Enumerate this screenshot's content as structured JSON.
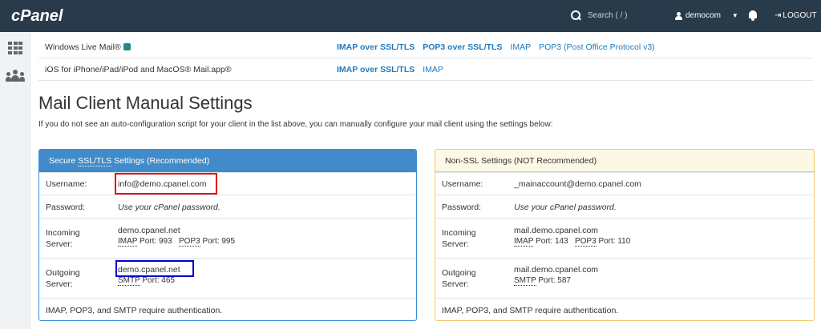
{
  "topbar": {
    "logo": "cPanel",
    "search_placeholder": "Search ( / )",
    "user": "democom",
    "logout": "LOGOUT"
  },
  "clients": [
    {
      "name": "Windows Live Mail®",
      "links": [
        "IMAP over SSL/TLS",
        "POP3 over SSL/TLS",
        "IMAP",
        "POP3 (Post Office Protocol v3)"
      ]
    },
    {
      "name": "iOS for iPhone/iPad/iPod and MacOS® Mail.app®",
      "links": [
        "IMAP over SSL/TLS",
        "IMAP"
      ]
    }
  ],
  "heading": "Mail Client Manual Settings",
  "intro": "If you do not see an auto-configuration script for your client in the list above, you can manually configure your mail client using the settings below:",
  "ssl": {
    "title_prefix": "Secure ",
    "title_abbr": "SSL/TLS",
    "title_suffix": " Settings (Recommended)",
    "username_label": "Username:",
    "username": "info@demo.cpanel.com",
    "password_label": "Password:",
    "password": "Use your cPanel password.",
    "incoming_label_1": "Incoming",
    "incoming_label_2": "Server:",
    "incoming_server": "demo.cpanel.net",
    "imap_abbr": "IMAP",
    "imap_port": " Port: 993",
    "pop3_abbr": "POP3",
    "pop3_port": " Port: 995",
    "outgoing_label_1": "Outgoing",
    "outgoing_label_2": "Server:",
    "outgoing_server": "demo.cpanel.net",
    "smtp_abbr": "SMTP",
    "smtp_port": " Port: 465",
    "auth_note": "IMAP, POP3, and SMTP require authentication."
  },
  "nonssl": {
    "title": "Non-SSL Settings (NOT Recommended)",
    "username_label": "Username:",
    "username": "_mainaccount@demo.cpanel.com",
    "password_label": "Password:",
    "password": "Use your cPanel password.",
    "incoming_label_1": "Incoming",
    "incoming_label_2": "Server:",
    "incoming_server": "mail.demo.cpanel.com",
    "imap_abbr": "IMAP",
    "imap_port": " Port: 143",
    "pop3_abbr": "POP3",
    "pop3_port": " Port: 110",
    "outgoing_label_1": "Outgoing",
    "outgoing_label_2": "Server:",
    "outgoing_server": "mail.demo.cpanel.com",
    "smtp_abbr": "SMTP",
    "smtp_port": " Port: 587",
    "auth_note": "IMAP, POP3, and SMTP require authentication."
  },
  "colors": {
    "topbar": "#293a4a",
    "ssl_header": "#428bca",
    "nonssl_header": "#fcf8e3",
    "link": "#1f7bbf",
    "highlight_red": "#e00000",
    "highlight_blue": "#0000d0"
  }
}
